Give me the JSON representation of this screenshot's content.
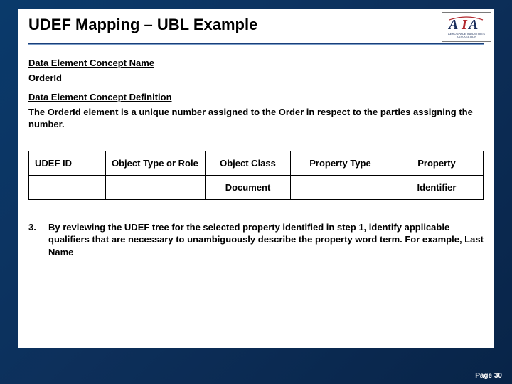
{
  "slide": {
    "title": "UDEF Mapping – UBL Example"
  },
  "sections": {
    "name_heading": "Data Element Concept Name",
    "name_value": "OrderId",
    "def_heading": "Data Element Concept Definition",
    "def_value": "The OrderId element is a unique number assigned to the Order in respect to the parties assigning the number."
  },
  "table": {
    "headers": {
      "c1": "UDEF ID",
      "c2": "Object Type or Role",
      "c3": "Object Class",
      "c4": "Property Type",
      "c5": "Property"
    },
    "row": {
      "c1": "",
      "c2": "",
      "c3": "Document",
      "c4": "",
      "c5": "Identifier"
    }
  },
  "step": {
    "num": "3.",
    "text": "By reviewing the UDEF tree for the selected property identified in step 1, identify applicable qualifiers that are necessary to unambiguously describe the property word term. For example, Last Name"
  },
  "footer": {
    "page": "Page 30"
  },
  "logo": {
    "text": "AIA",
    "sub": "AEROSPACE INDUSTRIES ASSOCIATION"
  }
}
